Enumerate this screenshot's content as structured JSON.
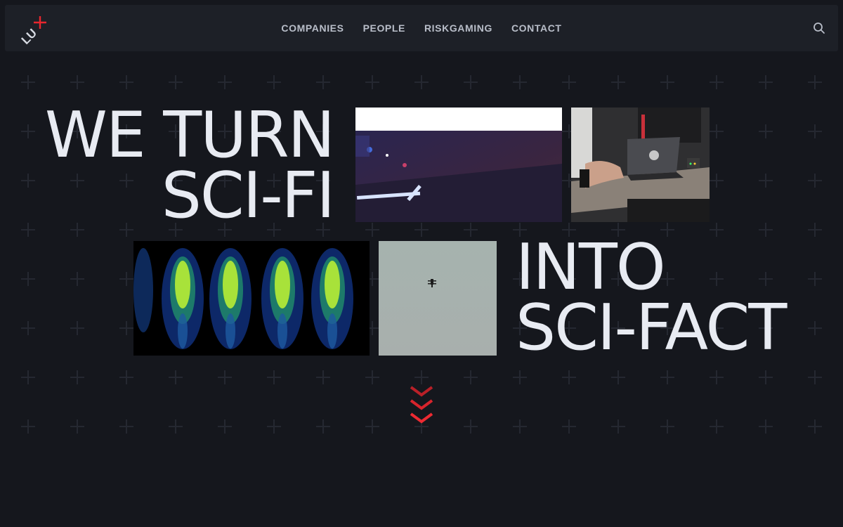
{
  "header": {
    "logo_text": "LUX",
    "nav": [
      {
        "label": "COMPANIES"
      },
      {
        "label": "PEOPLE"
      },
      {
        "label": "RISKGAMING"
      },
      {
        "label": "CONTACT"
      }
    ]
  },
  "hero": {
    "line1": "WE TURN",
    "line2": "SCI-FI",
    "line3": "INTO",
    "line4": "SCI-FACT"
  },
  "colors": {
    "background": "#15171d",
    "header": "#1d2027",
    "accent": "#e8262e",
    "text": "#e8ebf2",
    "nav_text": "#b9bec9"
  },
  "icons": {
    "search": "search-icon",
    "scroll": "chevron-down-icon"
  }
}
